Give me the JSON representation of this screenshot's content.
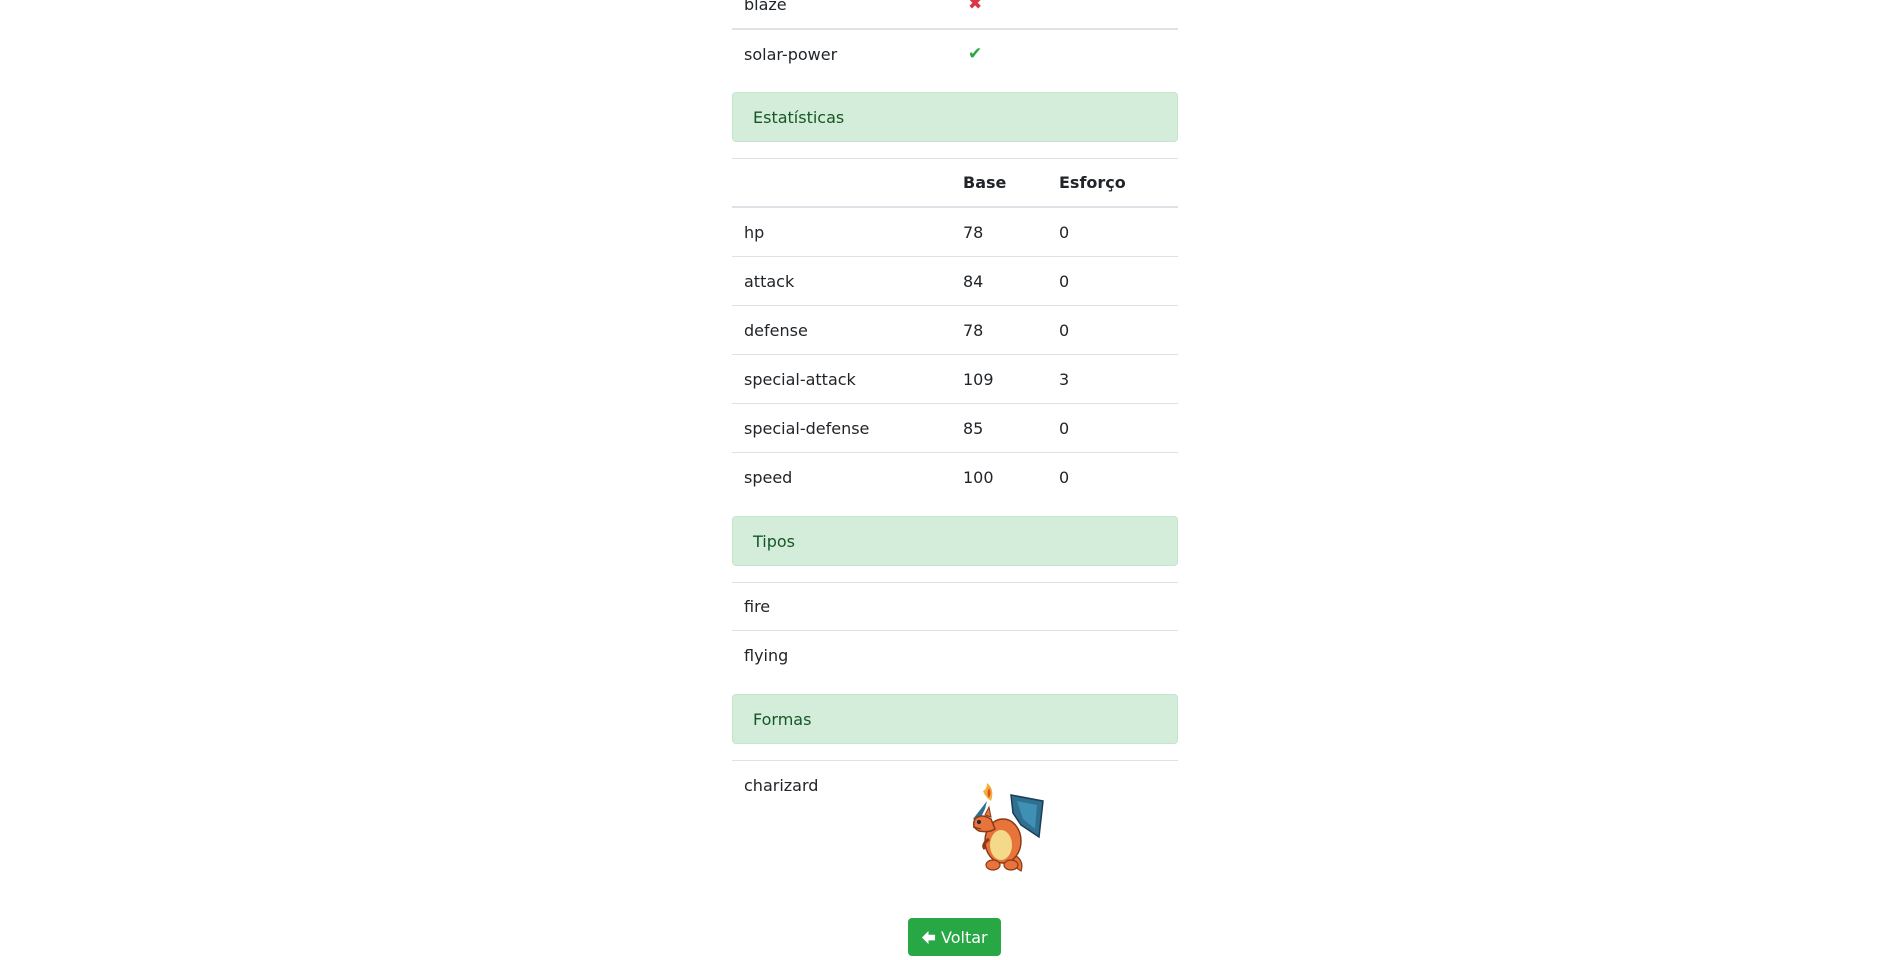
{
  "abilities": [
    {
      "name": "blaze",
      "hidden": false
    },
    {
      "name": "solar-power",
      "hidden": true
    }
  ],
  "stats_section": {
    "title": "Estatísticas",
    "headers": [
      "",
      "Base",
      "Esforço"
    ],
    "rows": [
      {
        "name": "hp",
        "base": "78",
        "effort": "0"
      },
      {
        "name": "attack",
        "base": "84",
        "effort": "0"
      },
      {
        "name": "defense",
        "base": "78",
        "effort": "0"
      },
      {
        "name": "special-attack",
        "base": "109",
        "effort": "3"
      },
      {
        "name": "special-defense",
        "base": "85",
        "effort": "0"
      },
      {
        "name": "speed",
        "base": "100",
        "effort": "0"
      }
    ]
  },
  "types_section": {
    "title": "Tipos",
    "types": [
      "fire",
      "flying"
    ]
  },
  "forms_section": {
    "title": "Formas",
    "forms": [
      {
        "name": "charizard",
        "sprite": "charizard-sprite"
      }
    ]
  },
  "back_button": {
    "label": "Voltar",
    "icon": "arrow-left-icon"
  },
  "colors": {
    "alert_bg": "#d4edda",
    "alert_text": "#155724",
    "button": "#28a745",
    "cross": "#dc3545",
    "check": "#28a745"
  }
}
